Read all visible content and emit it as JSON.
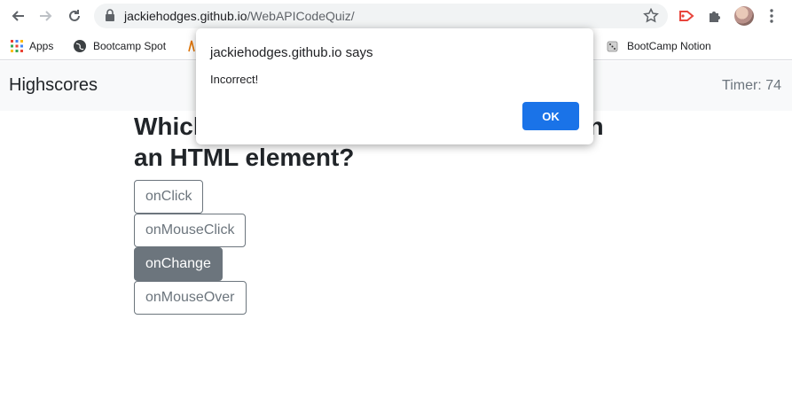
{
  "browser": {
    "url_domain": "jackiehodges.github.io",
    "url_path": "/WebAPICodeQuiz/",
    "bookmarks": [
      "Apps",
      "Bootcamp Spot",
      "BootCamp Notion"
    ]
  },
  "page": {
    "highscores_label": "Highscores",
    "timer": "Timer: 74",
    "question_line1": "Which",
    "question_line1_end": "s on",
    "question_line2": "an HTML element?",
    "answers": [
      "onClick",
      "onMouseClick",
      "onChange",
      "onMouseOver"
    ]
  },
  "dialog": {
    "title": "jackiehodges.github.io says",
    "message": "Incorrect!",
    "ok_label": "OK"
  },
  "colors": {
    "accent": "#1a73e8",
    "secondary": "#6c757d"
  }
}
